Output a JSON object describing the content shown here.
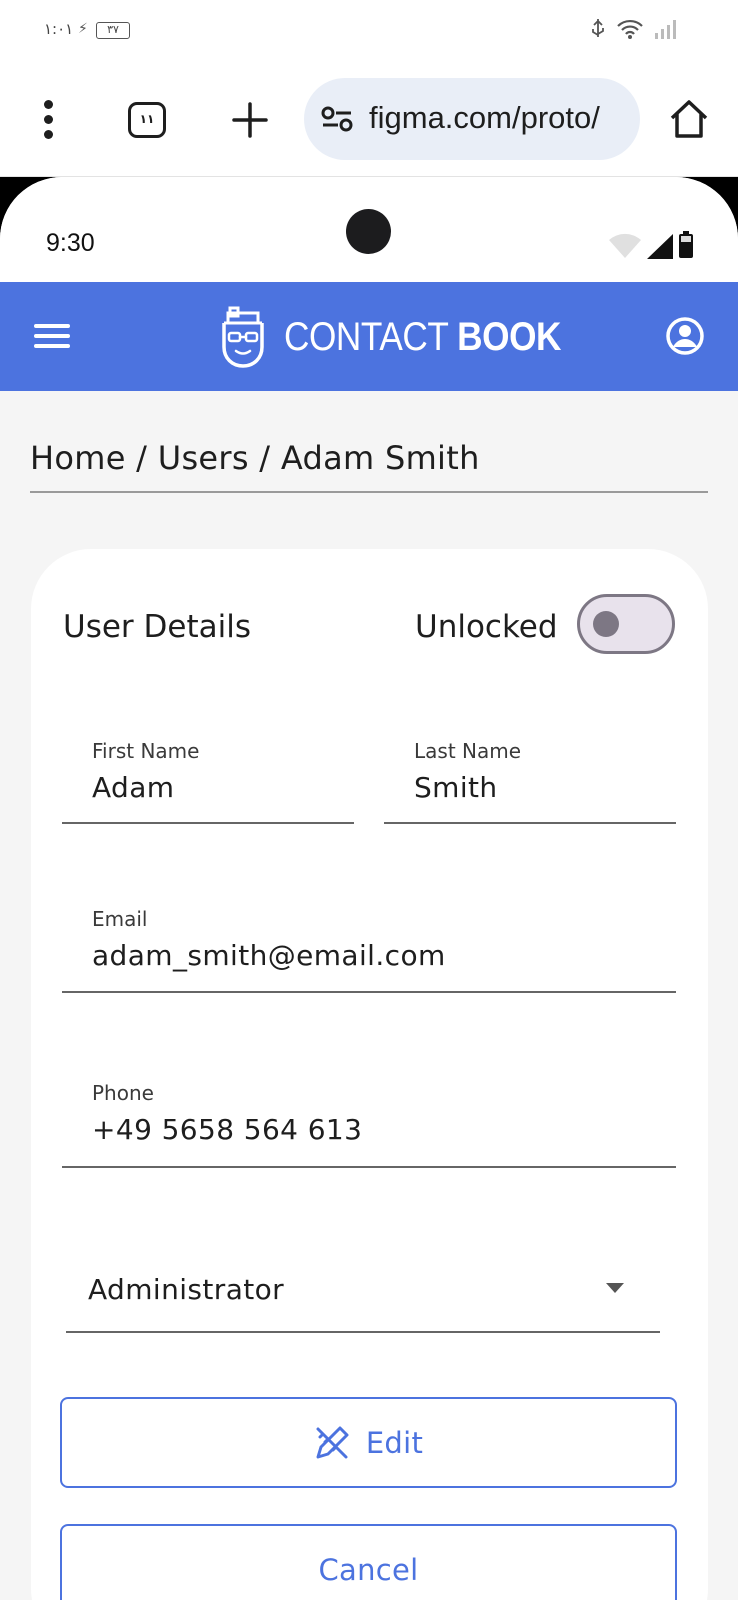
{
  "os_status": {
    "time": "١:٠١",
    "battery": "٣٧"
  },
  "browser": {
    "tab_count": "١١",
    "url": "figma.com/proto/"
  },
  "device": {
    "time": "9:30"
  },
  "app_bar": {
    "brand_light": "CONTACT",
    "brand_bold": "BOOK",
    "accent_color": "#4c73df"
  },
  "breadcrumb": {
    "text": "Home / Users / Adam Smith"
  },
  "card": {
    "title": "User Details",
    "lock_label": "Unlocked",
    "lock_toggle_on": false,
    "first_name": {
      "label": "First Name",
      "value": "Adam"
    },
    "last_name": {
      "label": "Last Name",
      "value": "Smith"
    },
    "email": {
      "label": "Email",
      "value": "adam_smith@email.com"
    },
    "phone": {
      "label": "Phone",
      "value": "+49 5658 564 613"
    },
    "role": {
      "value": "Administrator"
    },
    "edit_button": {
      "label": "Edit",
      "icon": "pencil-ruler-icon"
    },
    "cancel_button": {
      "label": "Cancel"
    }
  }
}
